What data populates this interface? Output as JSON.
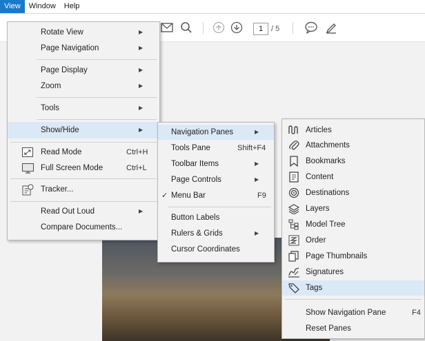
{
  "menubar": {
    "items": [
      {
        "label": "View",
        "active": true
      },
      {
        "label": "Window",
        "active": false
      },
      {
        "label": "Help",
        "active": false
      }
    ]
  },
  "toolbar": {
    "icons": [
      "email-icon",
      "search-icon",
      "page-up-icon",
      "page-down-icon",
      "comment-icon",
      "pen-icon"
    ],
    "page_current": "1",
    "page_total": "/ 5"
  },
  "colors": {
    "accent": "#1979ca",
    "highlight": "#dbe9f7",
    "menu_bg": "#f2f2f2"
  },
  "view_menu": {
    "items": [
      {
        "label": "Rotate View",
        "submenu": true
      },
      {
        "label": "Page Navigation",
        "submenu": true
      },
      {
        "label": "Page Display",
        "submenu": true
      },
      {
        "label": "Zoom",
        "submenu": true
      },
      {
        "label": "Tools",
        "submenu": true
      },
      {
        "label": "Show/Hide",
        "submenu": true,
        "highlighted": true
      },
      {
        "label": "Read Mode",
        "shortcut": "Ctrl+H",
        "icon": "read-mode-icon"
      },
      {
        "label": "Full Screen Mode",
        "shortcut": "Ctrl+L",
        "icon": "full-screen-icon"
      },
      {
        "label": "Tracker...",
        "icon": "tracker-icon"
      },
      {
        "label": "Read Out Loud",
        "submenu": true
      },
      {
        "label": "Compare Documents..."
      }
    ]
  },
  "showhide_menu": {
    "items": [
      {
        "label": "Navigation Panes",
        "submenu": true,
        "highlighted": true
      },
      {
        "label": "Tools Pane",
        "shortcut": "Shift+F4"
      },
      {
        "label": "Toolbar Items",
        "submenu": true
      },
      {
        "label": "Page Controls",
        "submenu": true
      },
      {
        "label": "Menu Bar",
        "shortcut": "F9",
        "checked": true
      },
      {
        "label": "Button Labels"
      },
      {
        "label": "Rulers & Grids",
        "submenu": true
      },
      {
        "label": "Cursor Coordinates"
      }
    ]
  },
  "navpanes_menu": {
    "items": [
      {
        "label": "Articles",
        "icon": "articles-icon"
      },
      {
        "label": "Attachments",
        "icon": "paperclip-icon"
      },
      {
        "label": "Bookmarks",
        "icon": "bookmark-icon"
      },
      {
        "label": "Content",
        "icon": "content-icon"
      },
      {
        "label": "Destinations",
        "icon": "destinations-icon"
      },
      {
        "label": "Layers",
        "icon": "layers-icon"
      },
      {
        "label": "Model Tree",
        "icon": "model-tree-icon"
      },
      {
        "label": "Order",
        "icon": "order-icon"
      },
      {
        "label": "Page Thumbnails",
        "icon": "page-thumbnails-icon"
      },
      {
        "label": "Signatures",
        "icon": "signatures-icon"
      },
      {
        "label": "Tags",
        "icon": "tag-icon",
        "highlighted": true
      },
      {
        "label": "Show Navigation Pane",
        "shortcut": "F4"
      },
      {
        "label": "Reset Panes"
      }
    ]
  }
}
